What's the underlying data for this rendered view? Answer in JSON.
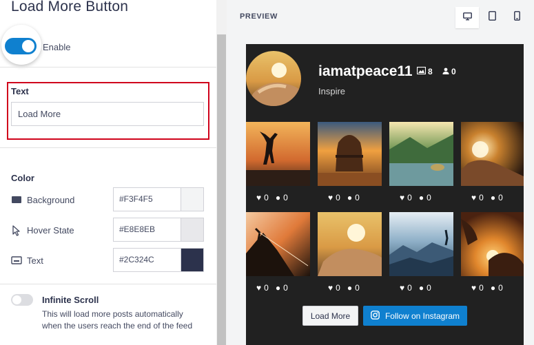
{
  "panel": {
    "title": "Load More Button",
    "enable_label": "Enable",
    "enabled": true
  },
  "text_setting": {
    "label": "Text",
    "value": "Load More"
  },
  "color": {
    "label": "Color",
    "rows": [
      {
        "name": "Background",
        "hex": "#F3F4F5",
        "icon": "fill-icon"
      },
      {
        "name": "Hover State",
        "hex": "#E8E8EB",
        "icon": "cursor-icon"
      },
      {
        "name": "Text",
        "hex": "#2C324C",
        "icon": "text-icon"
      }
    ]
  },
  "infinite_scroll": {
    "title": "Infinite Scroll",
    "enabled": false,
    "description": "This will load more posts automatically when the users reach the end of the feed"
  },
  "preview": {
    "label": "PREVIEW",
    "devices": [
      "desktop-icon",
      "tablet-icon",
      "mobile-icon"
    ],
    "active_device": "desktop-icon"
  },
  "feed": {
    "username": "iamatpeace11",
    "posts_count": "8",
    "followers_count": "0",
    "bio": "Inspire",
    "tiles": [
      {
        "likes": "0",
        "comments": "0"
      },
      {
        "likes": "0",
        "comments": "0"
      },
      {
        "likes": "0",
        "comments": "0"
      },
      {
        "likes": "0",
        "comments": "0"
      },
      {
        "likes": "0",
        "comments": "0"
      },
      {
        "likes": "0",
        "comments": "0"
      },
      {
        "likes": "0",
        "comments": "0"
      },
      {
        "likes": "0",
        "comments": "0"
      }
    ],
    "load_more_label": "Load More",
    "follow_label": "Follow on Instagram"
  },
  "colors": {
    "accent": "#0F80CF",
    "highlight_border": "#D0021B",
    "feed_bg": "#212121"
  }
}
